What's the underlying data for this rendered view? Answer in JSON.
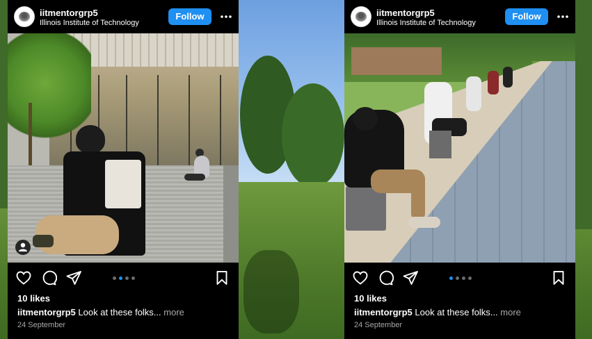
{
  "posts": [
    {
      "username": "iitmentorgrp5",
      "location": "Illinois Institute of Technology",
      "follow_label": "Follow",
      "likes": "10 likes",
      "caption_user": "iitmentorgrp5",
      "caption_text": " Look at these folks...",
      "caption_more": " more",
      "date": "24 September",
      "carousel_active_index": 1,
      "carousel_count": 4
    },
    {
      "username": "iitmentorgrp5",
      "location": "Illinois Institute of Technology",
      "follow_label": "Follow",
      "likes": "10 likes",
      "caption_user": "iitmentorgrp5",
      "caption_text": " Look at these folks...",
      "caption_more": " more",
      "date": "24 September",
      "carousel_active_index": 0,
      "carousel_count": 4
    }
  ],
  "icons": {
    "more": "more-horizontal-icon",
    "like": "heart-icon",
    "comment": "comment-icon",
    "share": "paper-plane-icon",
    "save": "bookmark-icon",
    "tagged": "user-tag-icon"
  },
  "colors": {
    "follow_button": "#1f8ff2",
    "carousel_active_dot": "#1f8ff2",
    "carousel_dot": "#6b6b6b",
    "muted_text": "#a8a8a8"
  }
}
